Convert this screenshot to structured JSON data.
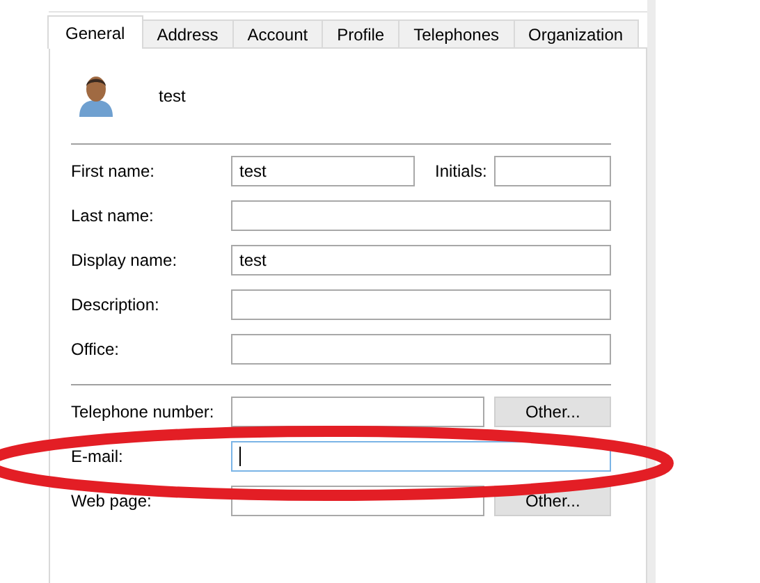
{
  "tabs": [
    {
      "label": "General",
      "selected": true
    },
    {
      "label": "Address",
      "selected": false
    },
    {
      "label": "Account",
      "selected": false
    },
    {
      "label": "Profile",
      "selected": false
    },
    {
      "label": "Telephones",
      "selected": false
    },
    {
      "label": "Organization",
      "selected": false
    }
  ],
  "user": {
    "name": "test"
  },
  "groups": [
    [
      {
        "kind": "split",
        "label": "First name:",
        "value": "test",
        "focused": false,
        "extra_label": "Initials:"
      },
      {
        "kind": "text",
        "label": "Last name:",
        "focused": false
      },
      {
        "kind": "text",
        "label": "Display name:",
        "value": "test",
        "focused": false
      },
      {
        "kind": "text",
        "label": "Description:",
        "focused": false
      },
      {
        "kind": "text",
        "label": "Office:",
        "focused": false
      }
    ],
    [
      {
        "kind": "button",
        "label": "Telephone number:",
        "focused": false,
        "button": "Other..."
      },
      {
        "kind": "text",
        "label": "E-mail:",
        "focused": true
      },
      {
        "kind": "button",
        "label": "Web page:",
        "focused": false,
        "button": "Other..."
      }
    ]
  ],
  "highlight": {
    "kind": "ellipse"
  }
}
